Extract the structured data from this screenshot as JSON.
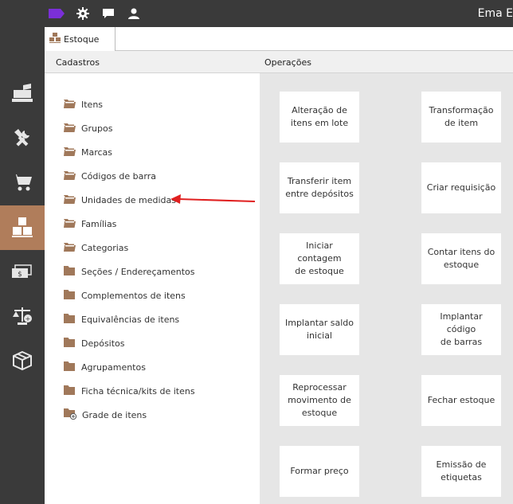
{
  "header": {
    "user_name": "Ema E"
  },
  "tab": {
    "label": "Estoque"
  },
  "columns": {
    "left": "Cadastros",
    "right": "Operações"
  },
  "cadastros": [
    {
      "label": "Itens",
      "icon": "open-folder"
    },
    {
      "label": "Grupos",
      "icon": "open-folder"
    },
    {
      "label": "Marcas",
      "icon": "open-folder"
    },
    {
      "label": "Códigos de barra",
      "icon": "open-folder"
    },
    {
      "label": "Unidades de medidas",
      "icon": "open-folder"
    },
    {
      "label": "Famílias",
      "icon": "open-folder"
    },
    {
      "label": "Categorias",
      "icon": "open-folder"
    },
    {
      "label": "Seções / Endereçamentos",
      "icon": "folder"
    },
    {
      "label": "Complementos de itens",
      "icon": "folder"
    },
    {
      "label": "Equivalências de itens",
      "icon": "folder"
    },
    {
      "label": "Depósitos",
      "icon": "folder"
    },
    {
      "label": "Agrupamentos",
      "icon": "folder"
    },
    {
      "label": "Ficha técnica/kits de itens",
      "icon": "folder"
    },
    {
      "label": "Grade de itens",
      "icon": "folder-add"
    }
  ],
  "operacoes": [
    [
      "Alteração de",
      "itens em lote"
    ],
    [
      "Transformação",
      "de item"
    ],
    [
      "Transferir item",
      "entre depósitos"
    ],
    [
      "Criar requisição"
    ],
    [
      "Iniciar contagem",
      "de estoque"
    ],
    [
      "Contar itens do",
      "estoque"
    ],
    [
      "Implantar saldo",
      "inicial"
    ],
    [
      "Implantar código",
      "de barras"
    ],
    [
      "Reprocessar",
      "movimento de",
      "estoque"
    ],
    [
      "Fechar estoque"
    ],
    [
      "Formar preço"
    ],
    [
      "Emissão de",
      "etiquetas"
    ]
  ],
  "colors": {
    "brand_purple": "#7b2fd8",
    "accent_brown": "#b07d5b",
    "folder_brown": "#a0785a",
    "annotation_red": "#e02020",
    "dark_bg": "#3a3a3a"
  }
}
